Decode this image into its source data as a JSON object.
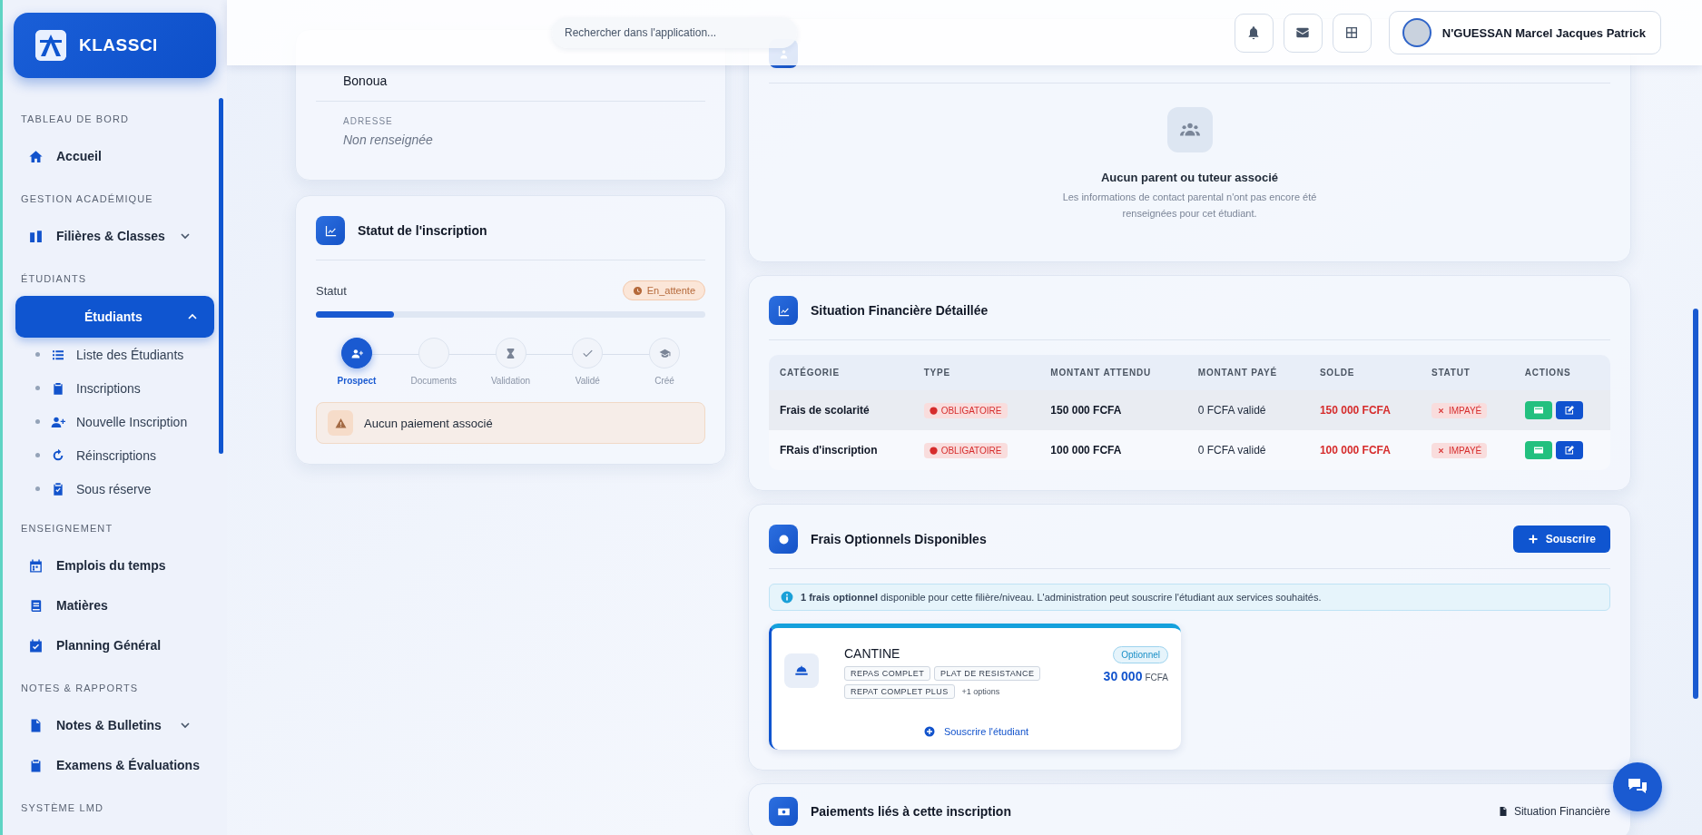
{
  "sidebar": {
    "brand": "KLASSCI",
    "sections": [
      {
        "title": "TABLEAU DE BORD",
        "items": [
          {
            "label": "Accueil",
            "kind": "link",
            "selected": false
          }
        ]
      },
      {
        "title": "GESTION ACADÉMIQUE",
        "items": [
          {
            "label": "Filières & Classes",
            "kind": "group",
            "selected": false,
            "expanded": false
          }
        ]
      },
      {
        "title": "ÉTUDIANTS",
        "items": [
          {
            "label": "Étudiants",
            "kind": "group",
            "selected": true,
            "expanded": true,
            "children": [
              {
                "label": "Liste des Étudiants"
              },
              {
                "label": "Inscriptions"
              },
              {
                "label": "Nouvelle Inscription"
              },
              {
                "label": "Réinscriptions"
              },
              {
                "label": "Sous réserve"
              }
            ]
          }
        ]
      },
      {
        "title": "ENSEIGNEMENT",
        "items": [
          {
            "label": "Emplois du temps",
            "kind": "link",
            "selected": false
          },
          {
            "label": "Matières",
            "kind": "link",
            "selected": false
          },
          {
            "label": "Planning Général",
            "kind": "link",
            "selected": false
          }
        ]
      },
      {
        "title": "NOTES & RAPPORTS",
        "items": [
          {
            "label": "Notes & Bulletins",
            "kind": "group",
            "selected": false,
            "expanded": false
          },
          {
            "label": "Examens & Évaluations",
            "kind": "link",
            "selected": false
          }
        ]
      },
      {
        "title": "SYSTÈME LMD"
      }
    ]
  },
  "header": {
    "search": {
      "placeholder": "Rechercher dans l'application..."
    },
    "user_name": "N'GUESSAN Marcel Jacques Patrick"
  },
  "address_card": {
    "fields": [
      {
        "value": "Bonoua",
        "empty": false
      },
      {
        "label": "ADRESSE",
        "value": "Non renseignée",
        "empty": true
      }
    ]
  },
  "status_card": {
    "title": "Statut de l'inscription",
    "status_label": "Statut",
    "status_badge": "En_attente",
    "level": 0.2,
    "steps": [
      {
        "label": "Prospect",
        "selected": true
      },
      {
        "label": "Documents",
        "selected": false
      },
      {
        "label": "Validation",
        "selected": false
      },
      {
        "label": "Validé",
        "selected": false
      },
      {
        "label": "Créé",
        "selected": false
      }
    ],
    "alert": "Aucun paiement associé"
  },
  "parents_card": {
    "empty_title": "Aucun parent ou tuteur associé",
    "empty_text": "Les informations de contact parental n'ont pas encore été renseignées pour cet étudiant."
  },
  "finance_card": {
    "title": "Situation Financière Détaillée",
    "columns": [
      "CATÉGORIE",
      "TYPE",
      "MONTANT ATTENDU",
      "MONTANT PAYÉ",
      "SOLDE",
      "STATUT",
      "ACTIONS"
    ],
    "rows": [
      {
        "category": "Frais de scolarité",
        "type": "OBLIGATOIRE",
        "expected": "150 000 FCFA",
        "paid": "0 FCFA validé",
        "balance": "150 000 FCFA",
        "status": "IMPAYÉ",
        "highlighted": true
      },
      {
        "category": "FRais d'inscription",
        "type": "OBLIGATOIRE",
        "expected": "100 000 FCFA",
        "paid": "0 FCFA validé",
        "balance": "100 000 FCFA",
        "status": "IMPAYÉ",
        "highlighted": false
      }
    ]
  },
  "optional_card": {
    "title": "Frais Optionnels Disponibles",
    "button": "Souscrire",
    "info": "**1 frais optionnel** disponible pour cette filière/niveau. L'administration peut souscrire l'étudiant aux services souhaités.",
    "fee": {
      "name": "CANTINE",
      "tags": [
        "REPAS COMPLET",
        "PLAT DE RESISTANCE",
        "REPAT COMPLET PLUS"
      ],
      "more": "+1 options",
      "badge": "Optionnel",
      "price": "30 000",
      "currency": "FCFA",
      "link": "Souscrire l'étudiant"
    }
  },
  "payments_card": {
    "title": "Paiements liés à cette inscription",
    "link": "Situation Financière"
  }
}
